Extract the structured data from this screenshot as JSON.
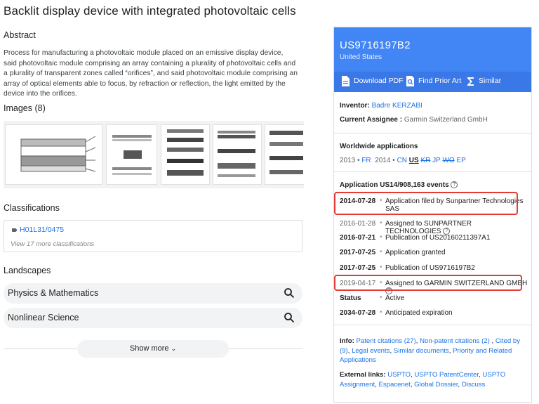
{
  "title": "Backlit display device with integrated photovoltaic cells",
  "abstract": {
    "heading": "Abstract",
    "text": "Process for manufacturing a photovoltaic module placed on an emissive display device, said photovoltaic module comprising an array containing a plurality of photovoltaic cells and a plurality of transparent zones called “orifices”, and said photovoltaic module comprising an array of optical elements able to focus, by refraction or reflection, the light emitted by the device into the orifices."
  },
  "images": {
    "heading": "Images (8)"
  },
  "classifications": {
    "heading": "Classifications",
    "code": "H01L31/0475",
    "more": "View 17 more classifications"
  },
  "landscapes": {
    "heading": "Landscapes",
    "items": [
      {
        "label": "Physics & Mathematics"
      },
      {
        "label": "Nonlinear Science"
      }
    ],
    "show_more": "Show more"
  },
  "panel": {
    "patent_number": "US9716197B2",
    "country": "United States",
    "actions": {
      "download": "Download PDF",
      "prior_art": "Find Prior Art",
      "similar": "Similar"
    },
    "inventor_label": "Inventor:",
    "inventor": "Badre KERZABI",
    "assignee_label": "Current Assignee :",
    "assignee": "Garmin Switzerland GmbH",
    "worldwide": {
      "heading": "Worldwide applications",
      "y2013": "2013",
      "fr": "FR",
      "y2014": "2014",
      "cn": "CN",
      "us": "US",
      "kr": "KR",
      "jp": "JP",
      "wo": "WO",
      "ep": "EP"
    },
    "events_heading": "Application US14/908,163 events",
    "events": [
      {
        "date": "2014-07-28",
        "text": "Application filed by Sunpartner Technologies SAS"
      },
      {
        "date": "2016-01-28",
        "text": "Assigned to SUNPARTNER TECHNOLOGIES"
      },
      {
        "date": "2016-07-21",
        "text": "Publication of US20160211397A1"
      },
      {
        "date": "2017-07-25",
        "text": "Application granted"
      },
      {
        "date": "2017-07-25",
        "text": "Publication of US9716197B2"
      },
      {
        "date": "2019-04-17",
        "text": "Assigned to GARMIN SWITZERLAND GMBH"
      },
      {
        "date": "Status",
        "text": "Active"
      },
      {
        "date": "2034-07-28",
        "text": "Anticipated expiration"
      }
    ],
    "info": {
      "label": "Info:",
      "patent_citations": "Patent citations (27)",
      "non_patent_citations": "Non-patent citations (2)",
      "cited_by": "Cited by (9)",
      "legal_events": "Legal events",
      "similar_documents": "Similar documents",
      "priority": "Priority and Related Applications"
    },
    "external": {
      "label": "External links:",
      "uspto": "USPTO",
      "patentcenter": "USPTO PatentCenter",
      "uspto_assignment": "USPTO Assignment",
      "espacenet": "Espacenet",
      "global_dossier": "Global Dossier",
      "discuss": "Discuss"
    }
  },
  "colors": {
    "header_blue": "#4285f4",
    "link": "#1a73e8",
    "highlight": "#e53935"
  }
}
